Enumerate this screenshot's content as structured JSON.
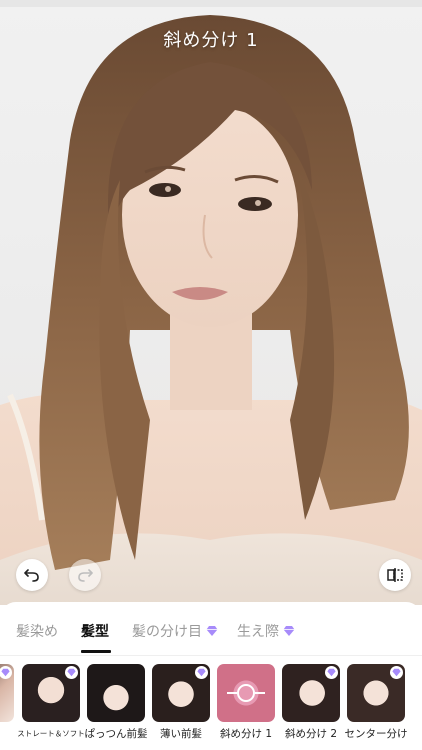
{
  "photo": {
    "style_title": "斜め分け 1"
  },
  "toolbar": {
    "undo_icon": "undo-icon",
    "redo_icon": "redo-icon",
    "compare_icon": "compare-icon"
  },
  "tabs": [
    {
      "label": "髪染め",
      "active": false,
      "premium": false
    },
    {
      "label": "髪型",
      "active": true,
      "premium": false
    },
    {
      "label": "髪の分け目",
      "active": false,
      "premium": true
    },
    {
      "label": "生え際",
      "active": false,
      "premium": true
    }
  ],
  "styles": [
    {
      "label": "",
      "premium": true
    },
    {
      "label": "ストレート＆ソフト",
      "premium": true
    },
    {
      "label": "ぱっつん前髪",
      "premium": false
    },
    {
      "label": "薄い前髪",
      "premium": true
    },
    {
      "label": "斜め分け 1",
      "premium": false,
      "selected": true
    },
    {
      "label": "斜め分け 2",
      "premium": true
    },
    {
      "label": "センター分け",
      "premium": true
    }
  ],
  "colors": {
    "accent": "#e8789a",
    "premium_gem": "#9b7bff",
    "active_tab": "#111111",
    "inactive_tab": "#9a9a9a"
  }
}
